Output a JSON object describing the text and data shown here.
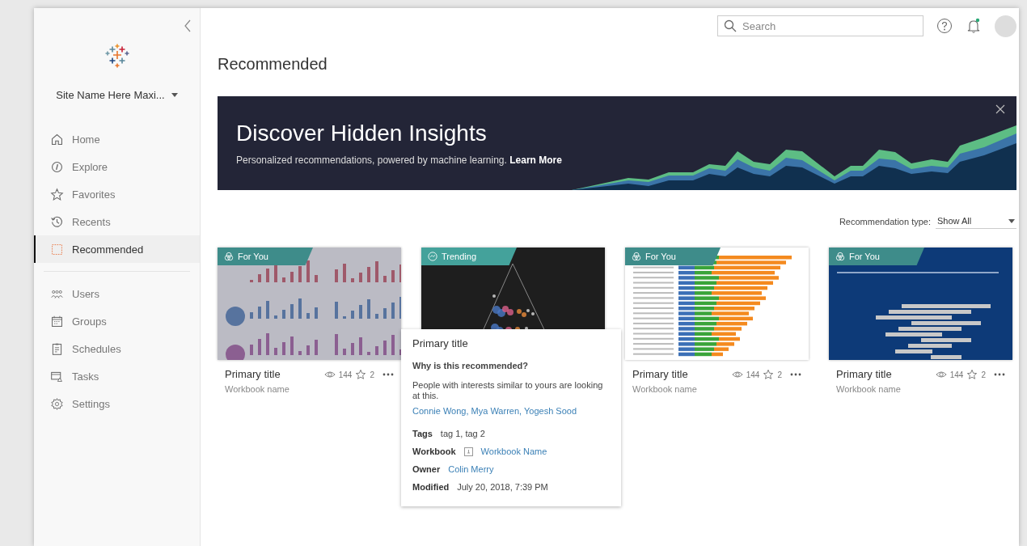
{
  "sidebar": {
    "site_name": "Site Name Here Maxi...",
    "items": [
      {
        "label": "Home",
        "selected": false
      },
      {
        "label": "Explore",
        "selected": false
      },
      {
        "label": "Favorites",
        "selected": false
      },
      {
        "label": "Recents",
        "selected": false
      },
      {
        "label": "Recommended",
        "selected": true
      },
      {
        "label": "Users",
        "selected": false
      },
      {
        "label": "Groups",
        "selected": false
      },
      {
        "label": "Schedules",
        "selected": false
      },
      {
        "label": "Tasks",
        "selected": false
      },
      {
        "label": "Settings",
        "selected": false
      }
    ]
  },
  "header": {
    "search": {
      "placeholder": "Search"
    }
  },
  "page_title": "Recommended",
  "banner": {
    "title": "Discover Hidden Insights",
    "text": "Personalized recommendations, powered by machine learning.",
    "link": "Learn More"
  },
  "filter": {
    "label": "Recommendation type:",
    "value": "Show All"
  },
  "cards": [
    {
      "tag": "For You",
      "kind": "for_you",
      "dimmed": true,
      "title": "Primary title",
      "workbook": "Workbook name",
      "views": "144",
      "favorites": "2"
    },
    {
      "tag": "Trending",
      "kind": "trending",
      "dimmed": false
    },
    {
      "tag": "For You",
      "kind": "for_you",
      "dimmed": false,
      "title": "Primary title",
      "workbook": "Workbook name",
      "views": "144",
      "favorites": "2"
    },
    {
      "tag": "For You",
      "kind": "for_you",
      "dimmed": false,
      "title": "Primary title",
      "workbook": "Workbook name",
      "views": "144",
      "favorites": "2"
    }
  ],
  "popover": {
    "title": "Primary title",
    "question": "Why is this recommended?",
    "reason": "People with interests similar to yours are looking at this.",
    "people": "Connie Wong, Mya Warren, Yogesh Sood",
    "fields": [
      {
        "label": "Tags",
        "value": "tag 1, tag 2",
        "kind": "text"
      },
      {
        "label": "Workbook",
        "value": "Workbook Name",
        "kind": "workbook"
      },
      {
        "label": "Owner",
        "value": "Colin Merry",
        "kind": "link"
      },
      {
        "label": "Modified",
        "value": "July 20, 2018, 7:39 PM",
        "kind": "text"
      }
    ]
  }
}
